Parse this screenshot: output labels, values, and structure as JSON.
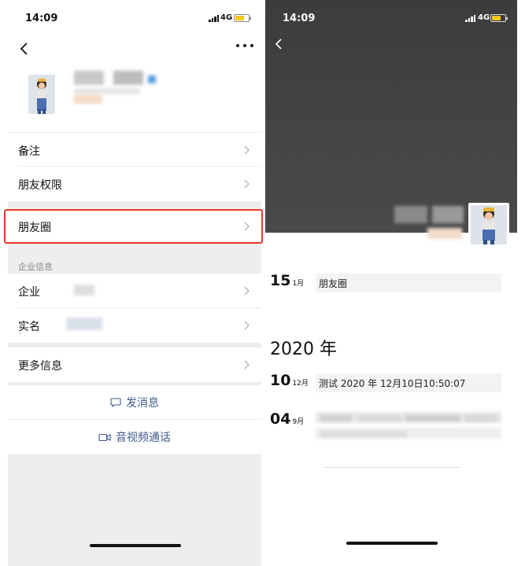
{
  "status": {
    "time": "14:09",
    "network": "4G"
  },
  "profile": {
    "menu_rows": [
      {
        "label": "备注"
      },
      {
        "label": "朋友权限"
      },
      {
        "label": "朋友圈"
      }
    ],
    "company_section_label": "企业信息",
    "company_rows": [
      {
        "label": "企业"
      },
      {
        "label": "实名"
      }
    ],
    "more_info_label": "更多信息",
    "send_message_label": "发消息",
    "video_call_label": "音视频通话"
  },
  "moments": {
    "posts": [
      {
        "day": "15",
        "month": "1月",
        "text": "朋友圈"
      }
    ],
    "year_label": "2020 年",
    "year_posts": [
      {
        "day": "10",
        "month": "12月",
        "text": "测试 2020 年 12月10日10:50:07"
      },
      {
        "day": "04",
        "month": "9月",
        "text": ""
      }
    ]
  },
  "colors": {
    "highlight": "#e8372c",
    "link": "#3f5a8a",
    "battery": "#f5c515",
    "background": "#ededed"
  },
  "icons": [
    "back-chevron-icon",
    "more-dots-icon",
    "chevron-right-icon",
    "message-bubble-icon",
    "video-camera-icon"
  ]
}
